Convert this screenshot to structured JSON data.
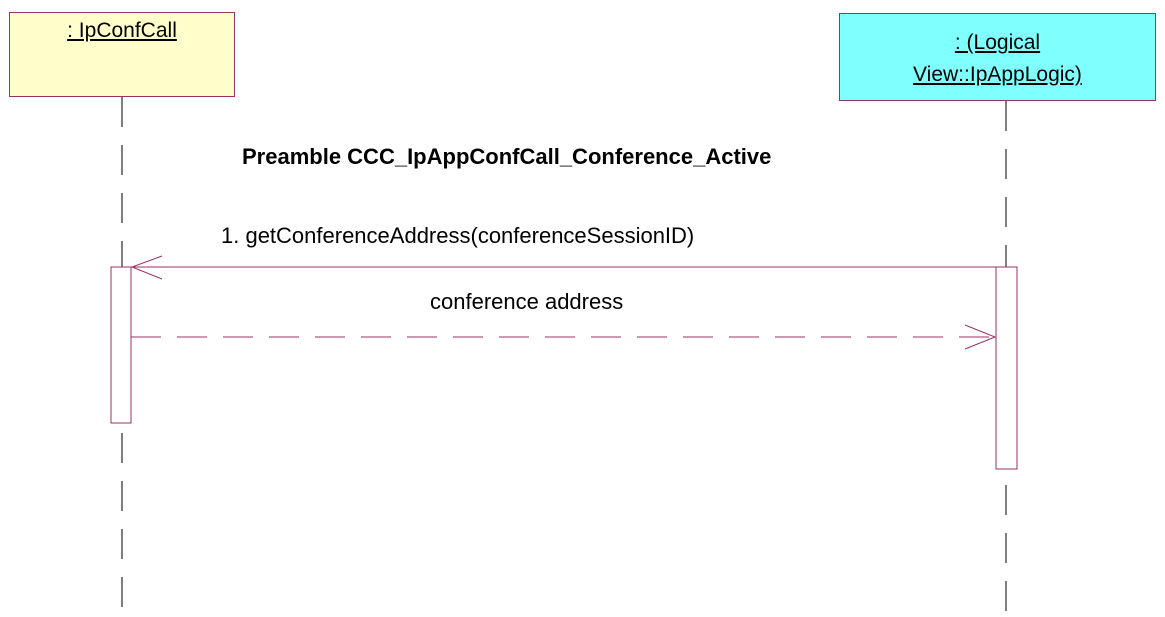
{
  "lifelines": [
    {
      "name": ": IpConfCall",
      "fill": "#ffffcc"
    },
    {
      "name_lines": [
        ": (Logical",
        "View::IpAppLogic)"
      ],
      "fill": "#80ffff"
    }
  ],
  "preamble": "Preamble CCC_IpAppConfCall_Conference_Active",
  "messages": [
    {
      "label": "1. getConferenceAddress(conferenceSessionID)",
      "kind": "call"
    },
    {
      "label": "conference address",
      "kind": "return"
    }
  ],
  "colors": {
    "line": "#993366",
    "lifeline": "#000000"
  }
}
